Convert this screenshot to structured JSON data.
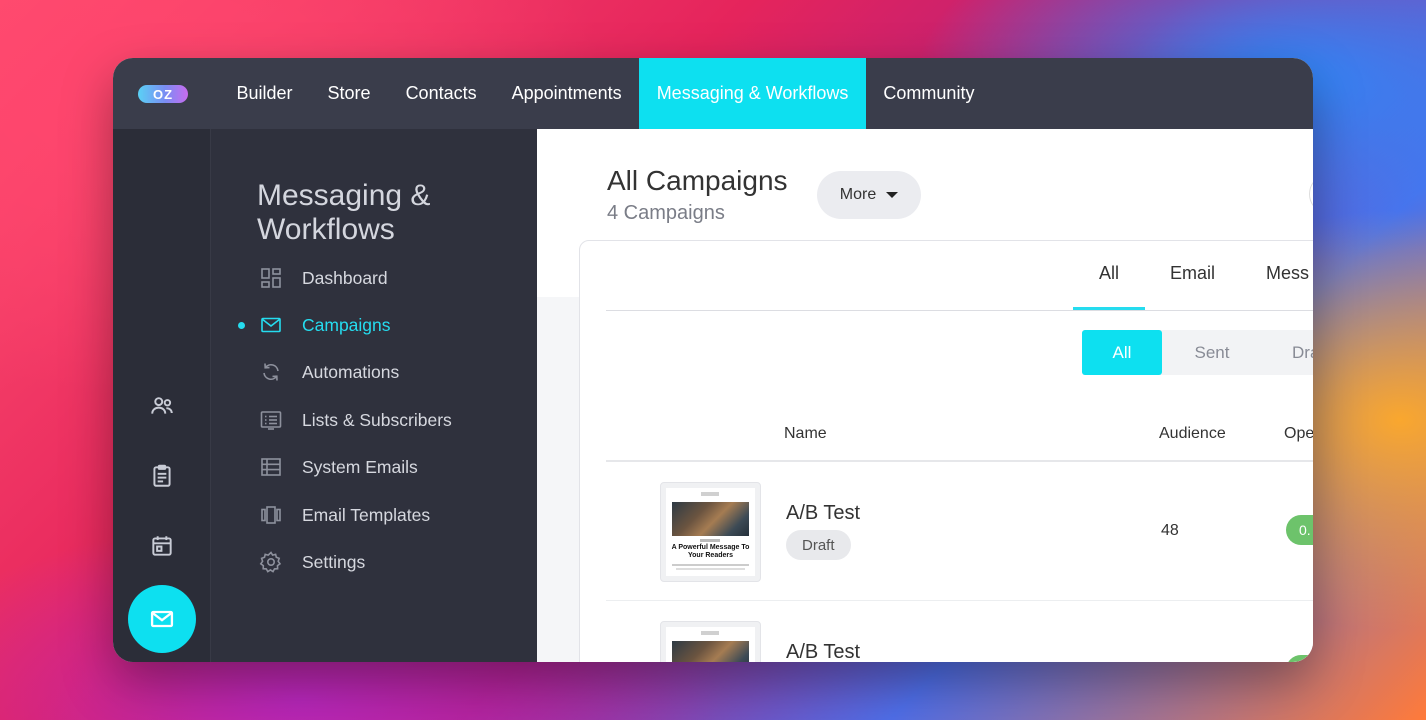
{
  "app": {
    "logo_text": "OZ",
    "brand_color": "#0de0f0"
  },
  "topnav": {
    "items": [
      {
        "label": "Builder"
      },
      {
        "label": "Store"
      },
      {
        "label": "Contacts"
      },
      {
        "label": "Appointments"
      },
      {
        "label": "Messaging & Workflows",
        "active": true
      },
      {
        "label": "Community"
      }
    ]
  },
  "rail": {
    "icons": [
      "contacts-icon",
      "clipboard-icon",
      "calendar-icon",
      "mail-icon"
    ],
    "active": "mail-icon"
  },
  "sidebar": {
    "title": "Messaging & Workflows",
    "items": [
      {
        "label": "Dashboard",
        "icon": "dashboard-icon"
      },
      {
        "label": "Campaigns",
        "icon": "mail-icon",
        "active": true
      },
      {
        "label": "Automations",
        "icon": "refresh-icon"
      },
      {
        "label": "Lists & Subscribers",
        "icon": "list-icon"
      },
      {
        "label": "System Emails",
        "icon": "table-icon"
      },
      {
        "label": "Email Templates",
        "icon": "templates-icon"
      },
      {
        "label": "Settings",
        "icon": "gear-icon"
      }
    ]
  },
  "main": {
    "title": "All Campaigns",
    "subtitle": "4 Campaigns",
    "more_label": "More",
    "tabs": [
      {
        "label": "All",
        "active": true
      },
      {
        "label": "Email"
      },
      {
        "label": "Mess"
      }
    ],
    "filters": [
      {
        "label": "All",
        "active": true
      },
      {
        "label": "Sent"
      },
      {
        "label": "Dra"
      }
    ],
    "columns": {
      "name": "Name",
      "audience": "Audience",
      "opens": "Ope"
    },
    "rows": [
      {
        "name": "A/B Test",
        "status": "Draft",
        "audience": "48",
        "opens": "0.",
        "thumb_headline": "A Powerful Message To Your Readers"
      },
      {
        "name": "A/B Test",
        "status": "",
        "audience": "",
        "opens": "",
        "thumb_headline": ""
      }
    ]
  }
}
